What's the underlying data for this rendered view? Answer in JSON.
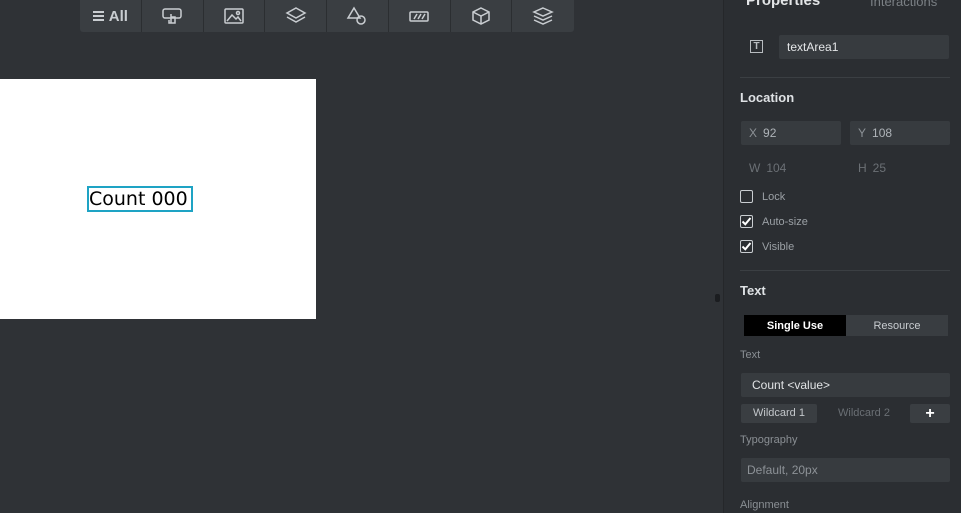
{
  "toolbar": {
    "all_label": "All",
    "tools": [
      {
        "icon": "touch-widget-icon"
      },
      {
        "icon": "image-icon"
      },
      {
        "icon": "layers-icon"
      },
      {
        "icon": "shapes-icon"
      },
      {
        "icon": "text-field-icon"
      },
      {
        "icon": "3d-box-icon"
      },
      {
        "icon": "stack-icon"
      }
    ]
  },
  "canvas": {
    "text_widget_value": "Count 000"
  },
  "panel": {
    "tab_properties": "Properties",
    "tab_interactions": "Interactions",
    "widget_name": "textArea1",
    "location": {
      "title": "Location",
      "x_label": "X",
      "x_value": "92",
      "y_label": "Y",
      "y_value": "108",
      "w_label": "W",
      "w_value": "104",
      "h_label": "H",
      "h_value": "25"
    },
    "checks": [
      {
        "label": "Lock",
        "checked": false
      },
      {
        "label": "Auto-size",
        "checked": true
      },
      {
        "label": "Visible",
        "checked": true
      }
    ],
    "text_section": {
      "title": "Text",
      "seg_single": "Single Use",
      "seg_resource": "Resource",
      "text_label": "Text",
      "text_value": "Count <value>",
      "wildcard1": "Wildcard 1",
      "wildcard2": "Wildcard 2",
      "plus": "+",
      "typography_label": "Typography",
      "typography_value": "Default, 20px",
      "alignment_label": "Alignment"
    }
  }
}
